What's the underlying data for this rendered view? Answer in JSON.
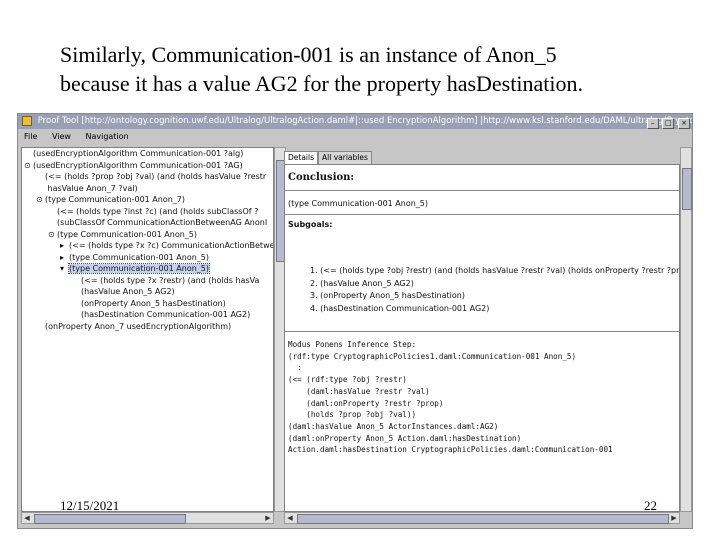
{
  "slide": {
    "title_line1": "Similarly, Communication-001 is an instance of Anon_5",
    "title_line2": "because it has a value AG2 for the property hasDestination.",
    "date": "12/15/2021",
    "page_number": "22"
  },
  "window": {
    "title": "Proof Tool [http://ontology.cognition.uwf.edu/Ultralog/UltralogAction.daml#|::used EncryptionAlgorithm] |http://www.ksl.stanford.edu/DAML/ultralog/Crypto...",
    "menu": [
      "File",
      "View",
      "Navigation"
    ]
  },
  "proof_tree": [
    {
      "indent": 0,
      "handle": "",
      "text": "(usedEncryptionAlgorithm Communication-001 ?alg)",
      "selected": false
    },
    {
      "indent": 0,
      "handle": "⊙",
      "text": "(usedEncryptionAlgorithm Communication-001 ?AG)",
      "selected": false
    },
    {
      "indent": 1,
      "handle": "",
      "text": "(<= (holds ?prop ?obj ?val) (and (holds hasValue ?restr",
      "selected": false
    },
    {
      "indent": 1,
      "handle": "",
      "text": "  hasValue Anon_7 ?val)",
      "selected": false
    },
    {
      "indent": 1,
      "handle": "⊙",
      "text": "(type Communication-001 Anon_7)",
      "selected": false
    },
    {
      "indent": 2,
      "handle": "",
      "text": "(<= (holds type ?inst ?c) (and (holds subClassOf ?",
      "selected": false
    },
    {
      "indent": 2,
      "handle": "",
      "text": "(subClassOf CommunicationActionBetweenAG AnonI",
      "selected": false
    },
    {
      "indent": 2,
      "handle": "⊙",
      "text": "(type Communication-001 Anon_5)",
      "selected": false
    },
    {
      "indent": 3,
      "handle": "▸",
      "text": "(<= (holds type ?x ?c) CommunicationActionBetwee",
      "selected": false
    },
    {
      "indent": 3,
      "handle": "▸",
      "text": "(type Communication-001 Anon_5)",
      "selected": false
    },
    {
      "indent": 3,
      "handle": "▾",
      "text": "(type Communication-001 Anon_5)",
      "selected": true
    },
    {
      "indent": 4,
      "handle": "",
      "text": "(<= (holds type ?x ?restr) (and (holds hasVa",
      "selected": false
    },
    {
      "indent": 4,
      "handle": "",
      "text": "(hasValue Anon_5 AG2)",
      "selected": false
    },
    {
      "indent": 4,
      "handle": "",
      "text": "(onProperty Anon_5 hasDestination)",
      "selected": false
    },
    {
      "indent": 4,
      "handle": "",
      "text": "(hasDestination Communication-001 AG2)",
      "selected": false
    },
    {
      "indent": 1,
      "handle": "",
      "text": "(onProperty Anon_7 usedEncryptionAlgorithm)",
      "selected": false
    }
  ],
  "tabs": [
    {
      "label": "Details",
      "active": true
    },
    {
      "label": "All variables",
      "active": false
    }
  ],
  "details": {
    "conclusion_heading": "Conclusion:",
    "conclusion_text": "(type Communication-001 Anon_5)",
    "subgoals_heading": "Subgoals:",
    "subgoals": [
      "1. (<= (holds type ?obj ?restr) (and (holds hasValue ?restr ?val) (holds onProperty ?restr ?prop)",
      "2. (hasValue Anon_5 AG2)",
      "3. (onProperty Anon_5 hasDestination)",
      "4. (hasDestination Communication-001 AG2)"
    ],
    "mono_text": "Modus Ponens Inference Step:\n(rdf:type CryptographicPolicies1.daml:Communication-001 Anon_5)\n  :\n(<= (rdf:type ?obj ?restr)\n    (daml:hasValue ?restr ?val)\n    (daml:onProperty ?restr ?prop)\n    (holds ?prop ?obj ?val))\n(daml:hasValue Anon_5 ActorInstances.daml:AG2)\n(daml:onProperty Anon_5 Action.daml:hasDestination)\nAction.daml:hasDestination CryptographicPolicies.daml:Communication-001"
  }
}
